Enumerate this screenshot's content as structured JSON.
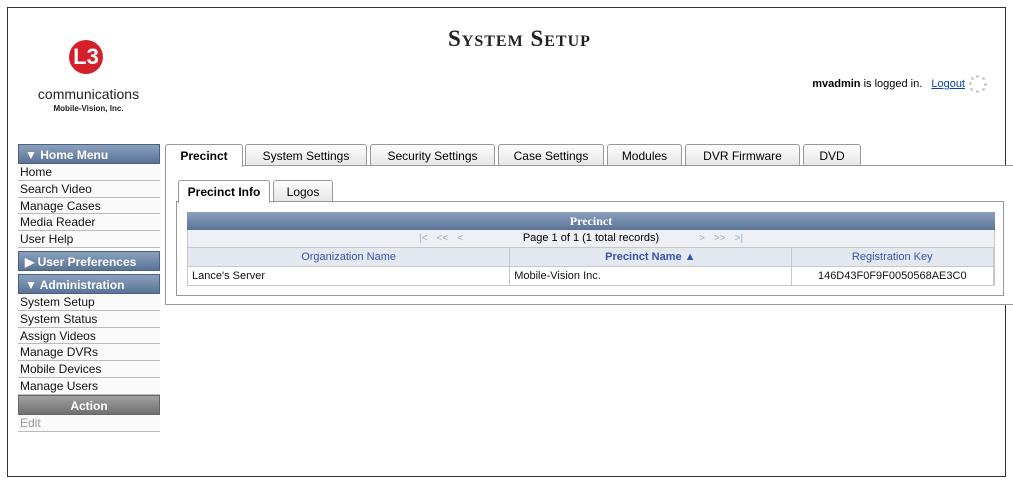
{
  "header": {
    "title": "System Setup",
    "username": "mvadmin",
    "logged_in_text": "is logged in.",
    "logout_label": "Logout"
  },
  "logo": {
    "mark": "L3",
    "brand": "communications",
    "subtitle": "Mobile-Vision, Inc."
  },
  "sidebar": {
    "home_menu": "▼ Home Menu",
    "home_items": [
      "Home",
      "Search Video",
      "Manage Cases",
      "Media Reader",
      "User Help"
    ],
    "user_prefs": "▶ User Preferences",
    "administration": "▼ Administration",
    "admin_items": [
      "System Setup",
      "System Status",
      "Assign Videos",
      "Manage DVRs",
      "Mobile Devices",
      "Manage Users"
    ],
    "action": "Action",
    "action_items": [
      "Edit"
    ]
  },
  "tabs": [
    "Precinct",
    "System Settings",
    "Security Settings",
    "Case Settings",
    "Modules",
    "DVR Firmware",
    "DVD"
  ],
  "subtabs": [
    "Precinct Info",
    "Logos"
  ],
  "grid": {
    "title": "Precinct",
    "pager_text": "Page 1 of 1 (1 total records)",
    "pager_first": "|<",
    "pager_prev2": "<<",
    "pager_prev": "<",
    "pager_next": ">",
    "pager_next2": ">>",
    "pager_last": ">|",
    "columns": [
      "Organization Name",
      "Precinct Name ▲",
      "Registration Key"
    ],
    "rows": [
      [
        "Lance's Server",
        "Mobile-Vision Inc.",
        "146D43F0F9F0050568AE3C0"
      ]
    ]
  }
}
